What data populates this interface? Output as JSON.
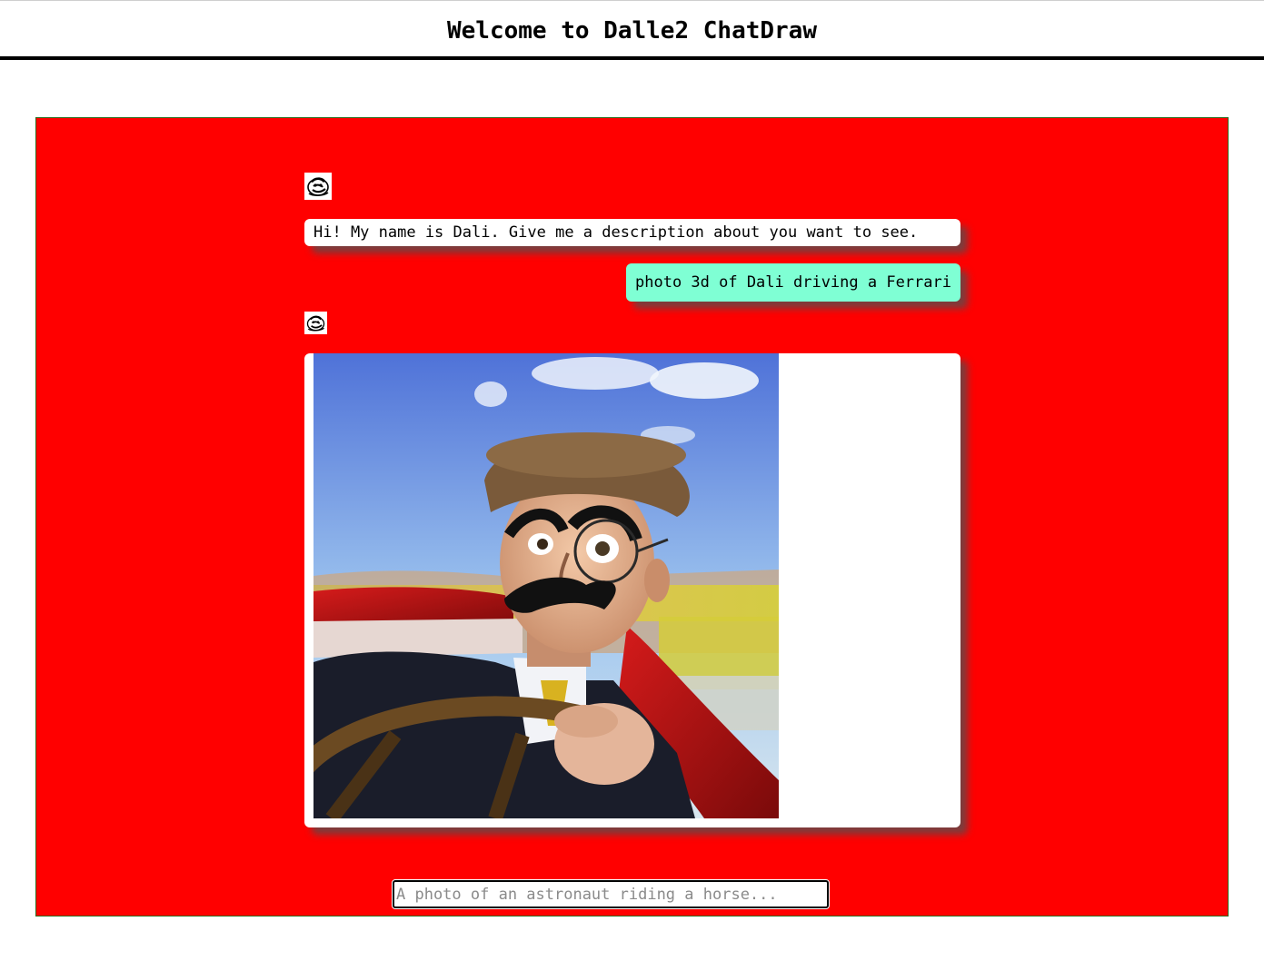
{
  "header": {
    "title": "Welcome to Dalle2 ChatDraw"
  },
  "colors": {
    "chat_background": "#ff0000",
    "bot_bubble": "#ffffff",
    "user_bubble": "#7fffd4",
    "header_rule": "#000000"
  },
  "chat": {
    "messages": [
      {
        "sender": "bot",
        "avatar_icon": "dali-avatar-icon",
        "text": "Hi! My name is Dali. Give me a description about you want to see."
      },
      {
        "sender": "user",
        "text": "photo 3d of Dali driving a Ferrari"
      },
      {
        "sender": "bot",
        "avatar_icon": "dali-avatar-icon",
        "image_icon": "generated-image"
      }
    ]
  },
  "input": {
    "value": "",
    "placeholder": "A photo of an astronaut riding a horse..."
  }
}
